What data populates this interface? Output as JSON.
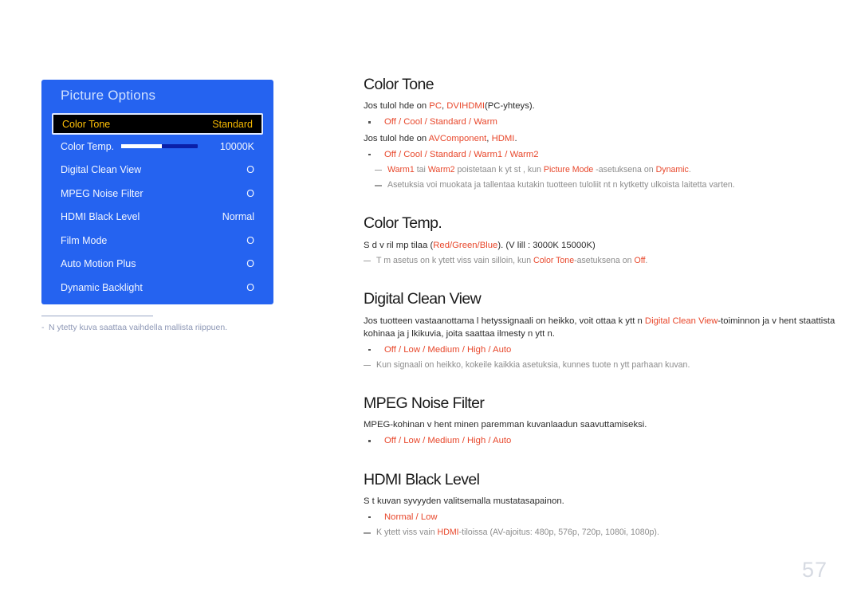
{
  "osd": {
    "title": "Picture Options",
    "rows": [
      {
        "label": "Color Tone",
        "value": "Standard",
        "selected": true,
        "slider": false
      },
      {
        "label": "Color Temp.",
        "value": "10000K",
        "selected": false,
        "slider": true
      },
      {
        "label": "Digital Clean View",
        "value": "O",
        "selected": false,
        "slider": false
      },
      {
        "label": "MPEG Noise Filter",
        "value": "O",
        "selected": false,
        "slider": false
      },
      {
        "label": "HDMI Black Level",
        "value": "Normal",
        "selected": false,
        "slider": false
      },
      {
        "label": "Film Mode",
        "value": "O",
        "selected": false,
        "slider": false
      },
      {
        "label": "Auto Motion Plus",
        "value": "O",
        "selected": false,
        "slider": false
      },
      {
        "label": "Dynamic Backlight",
        "value": "O",
        "selected": false,
        "slider": false
      }
    ],
    "footnote": "N ytetty kuva saattaa vaihdella mallista riippuen."
  },
  "sections": {
    "color_tone": {
      "heading": "Color Tone",
      "intro_pc_pre": "Jos tulol hde on ",
      "intro_pc_src1": "PC",
      "intro_pc_mid": ", ",
      "intro_pc_src2": "DVI",
      "intro_pc_src3": "HDMI",
      "intro_pc_post": "(PC-yhteys).",
      "options_pc": "Off / Cool / Standard / Warm",
      "intro_av_pre": "Jos tulol hde on ",
      "intro_av_src1": "AV",
      "intro_av_src2": "Component",
      "intro_av_mid": ", ",
      "intro_av_src3": "HDMI",
      "intro_av_post": ".",
      "options_av": "Off / Cool / Standard / Warm1 / Warm2",
      "note1_a": "Warm1",
      "note1_b": " tai ",
      "note1_c": "Warm2",
      "note1_d": " poistetaan k yt st , kun ",
      "note1_e": "Picture Mode",
      "note1_f": " -asetuksena on ",
      "note1_g": "Dynamic",
      "note1_h": ".",
      "note2": "Asetuksia voi muokata ja tallentaa kutakin tuotteen tuloliit nt  n kytketty  ulkoista laitetta varten."
    },
    "color_temp": {
      "heading": "Color Temp.",
      "body_pre": "S  d  v ril mp tilaa (",
      "body_c1": "Red",
      "body_s1": "/",
      "body_c2": "Green",
      "body_s2": "/",
      "body_c3": "Blue",
      "body_post": "). (V lill : 3000K 15000K)",
      "note_pre": "T m  asetus on k ytett viss  vain silloin, kun ",
      "note_link": "Color Tone",
      "note_mid": "-asetuksena on ",
      "note_val": "Off",
      "note_post": "."
    },
    "digital_clean_view": {
      "heading": "Digital Clean View",
      "body_pre": "Jos tuotteen vastaanottama l hetyssignaali on heikko, voit ottaa k ytt n ",
      "body_link": "Digital Clean View",
      "body_post": "-toiminnon ja v hent  staattista kohinaa ja j lkikuvia, joita saattaa ilmesty  n ytt n.",
      "options": "Off / Low / Medium / High / Auto",
      "note": "Kun signaali on heikko, kokeile kaikkia asetuksia, kunnes tuote n ytt  parhaan kuvan."
    },
    "mpeg_noise_filter": {
      "heading": "MPEG Noise Filter",
      "body": "MPEG-kohinan v hent minen paremman kuvanlaadun saavuttamiseksi.",
      "options": "Off / Low / Medium / High / Auto"
    },
    "hdmi_black_level": {
      "heading": "HDMI Black Level",
      "body": "S t  kuvan syvyyden valitsemalla mustatasapainon.",
      "options": "Normal / Low",
      "note_pre": "K ytett viss  vain ",
      "note_link": "HDMI",
      "note_post": "-tiloissa (AV-ajoitus: 480p, 576p, 720p, 1080i, 1080p)."
    }
  },
  "page_number": "57",
  "colors": {
    "osd_blue": "#2563f0",
    "osd_selected_bg": "#000000",
    "osd_selected_text": "#ffc107",
    "accent_red": "#e8472b",
    "note_gray": "#8c8c8c",
    "page_num_gray": "#d6dae2"
  }
}
